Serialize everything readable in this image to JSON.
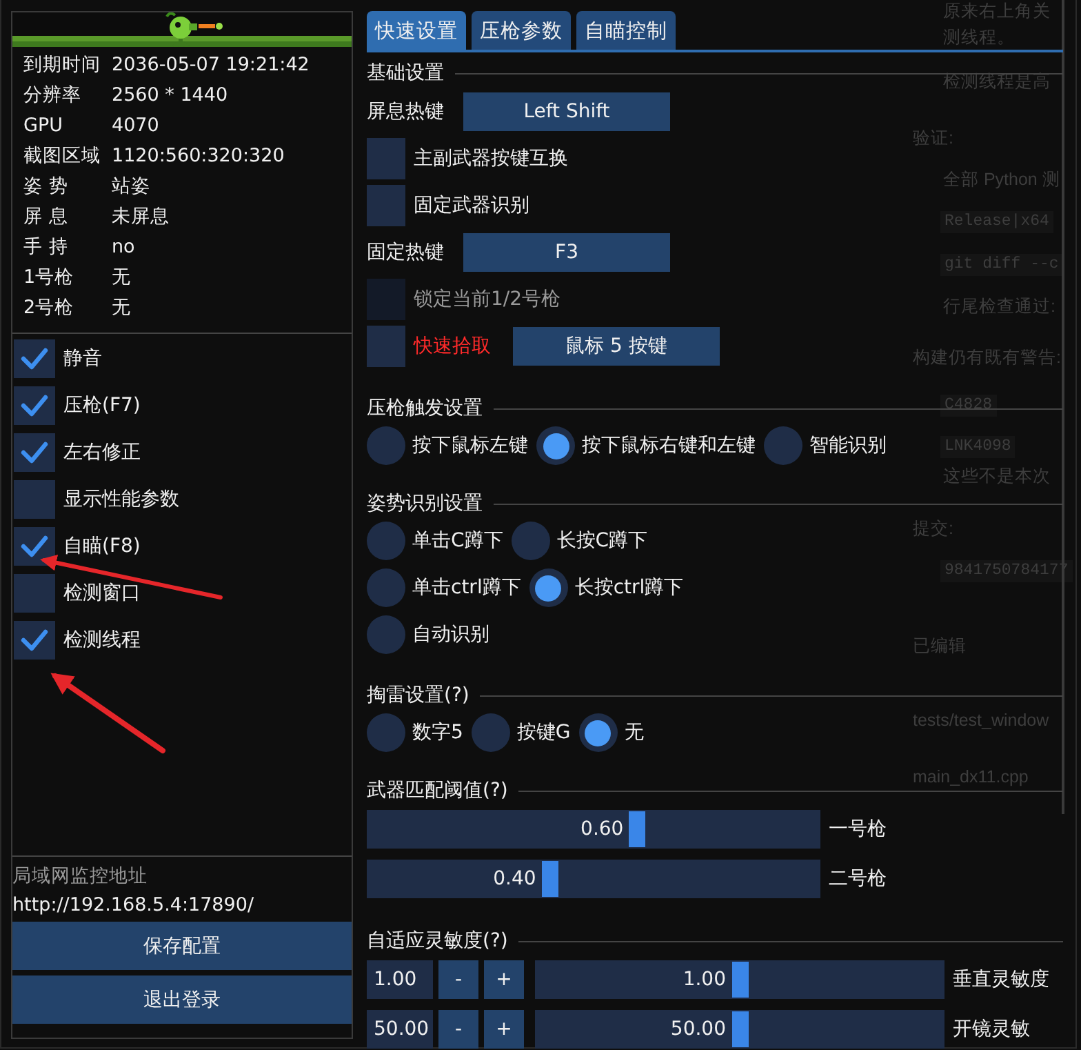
{
  "sidebar": {
    "info": [
      {
        "label": "到期时间",
        "value": "2036-05-07 19:21:42"
      },
      {
        "label": "分辨率",
        "value": "2560 * 1440"
      },
      {
        "label": "GPU",
        "value": "4070"
      },
      {
        "label": "截图区域",
        "value": "1120:560:320:320"
      },
      {
        "label": "姿 势",
        "value": "站姿"
      },
      {
        "label": "屏 息",
        "value": "未屏息"
      },
      {
        "label": "手 持",
        "value": "no"
      },
      {
        "label": "1号枪",
        "value": "无"
      },
      {
        "label": "2号枪",
        "value": "无"
      }
    ],
    "toggles": [
      {
        "label": "静音",
        "checked": true
      },
      {
        "label": "压枪(F7)",
        "checked": true
      },
      {
        "label": "左右修正",
        "checked": true
      },
      {
        "label": "显示性能参数",
        "checked": false
      },
      {
        "label": "自瞄(F8)",
        "checked": true
      },
      {
        "label": "检测窗口",
        "checked": false
      },
      {
        "label": "检测线程",
        "checked": true
      }
    ],
    "lan_label": "局域网监控地址",
    "lan_url": "http://192.168.5.4:17890/",
    "buttons": [
      "保存配置",
      "退出登录"
    ]
  },
  "tabs": [
    {
      "label": "快速设置",
      "selected": true
    },
    {
      "label": "压枪参数",
      "selected": false
    },
    {
      "label": "自瞄控制",
      "selected": false
    }
  ],
  "basic": {
    "title": "基础设置",
    "rows": [
      {
        "kind": "hotkey",
        "label": "屏息热键",
        "key": "Left Shift"
      },
      {
        "kind": "check",
        "label": "主副武器按键互换",
        "checked": false,
        "disabled": false
      },
      {
        "kind": "check",
        "label": "固定武器识别",
        "checked": false,
        "disabled": false
      },
      {
        "kind": "hotkey",
        "label": "固定热键",
        "key": "F3"
      },
      {
        "kind": "check",
        "label": "锁定当前1/2号枪",
        "checked": false,
        "disabled": true
      },
      {
        "kind": "check_key",
        "label": "快速拾取",
        "checked": false,
        "highlight": true,
        "key": "鼠标 5 按键"
      }
    ]
  },
  "radio_groups": [
    {
      "title": "压枪触发设置",
      "rows": [
        [
          {
            "label": "按下鼠标左键",
            "selected": false
          },
          {
            "label": "按下鼠标右键和左键",
            "selected": true
          },
          {
            "label": "智能识别",
            "selected": false
          }
        ]
      ]
    },
    {
      "title": "姿势识别设置",
      "rows": [
        [
          {
            "label": "单击C蹲下",
            "selected": false
          },
          {
            "label": "长按C蹲下",
            "selected": false
          }
        ],
        [
          {
            "label": "单击ctrl蹲下",
            "selected": false
          },
          {
            "label": "长按ctrl蹲下",
            "selected": true
          }
        ],
        [
          {
            "label": "自动识别",
            "selected": false
          }
        ]
      ]
    },
    {
      "title": "掏雷设置(?)",
      "rows": [
        [
          {
            "label": "数字5",
            "selected": false
          },
          {
            "label": "按键G",
            "selected": false
          },
          {
            "label": "无",
            "selected": true
          }
        ]
      ]
    }
  ],
  "threshold": {
    "title": "武器匹配阈值(?)",
    "sliders": [
      {
        "value": "0.60",
        "level": 0.6,
        "label": "一号枪"
      },
      {
        "value": "0.40",
        "level": 0.4,
        "label": "二号枪"
      }
    ]
  },
  "sensitivity": {
    "title": "自适应灵敏度(?)",
    "rows": [
      {
        "input": "1.00",
        "minus": "-",
        "plus": "+",
        "value": "1.00",
        "level": 0.5,
        "label": "垂直灵敏度"
      },
      {
        "input": "50.00",
        "minus": "-",
        "plus": "+",
        "value": "50.00",
        "level": 0.5,
        "label": "开镜灵敏"
      }
    ]
  },
  "background_window": {
    "lines": [
      {
        "kind": "bullet",
        "text": "原来右上角关"
      },
      {
        "kind": "plain",
        "text": "测线程。"
      },
      {
        "kind": "bullet",
        "text": "检测线程是高"
      },
      {
        "kind": "heading",
        "text": "验证:"
      },
      {
        "kind": "bullet",
        "text": "全部 Python 测"
      },
      {
        "kind": "code",
        "text": "Release|x64"
      },
      {
        "kind": "code",
        "text": "git diff --c"
      },
      {
        "kind": "bullet",
        "text": "行尾检查通过:"
      },
      {
        "kind": "heading",
        "text": "构建仍有既有警告:"
      },
      {
        "kind": "code",
        "text": "C4828"
      },
      {
        "kind": "code",
        "text": "LNK4098"
      },
      {
        "kind": "plain",
        "text": "这些不是本次"
      },
      {
        "kind": "heading",
        "text": "提交:"
      },
      {
        "kind": "code",
        "text": "9841750784177"
      },
      {
        "kind": "heading",
        "text": "已编辑"
      },
      {
        "kind": "heading",
        "text": "tests/test_window"
      },
      {
        "kind": "heading",
        "text": "main_dx11.cpp"
      }
    ]
  }
}
